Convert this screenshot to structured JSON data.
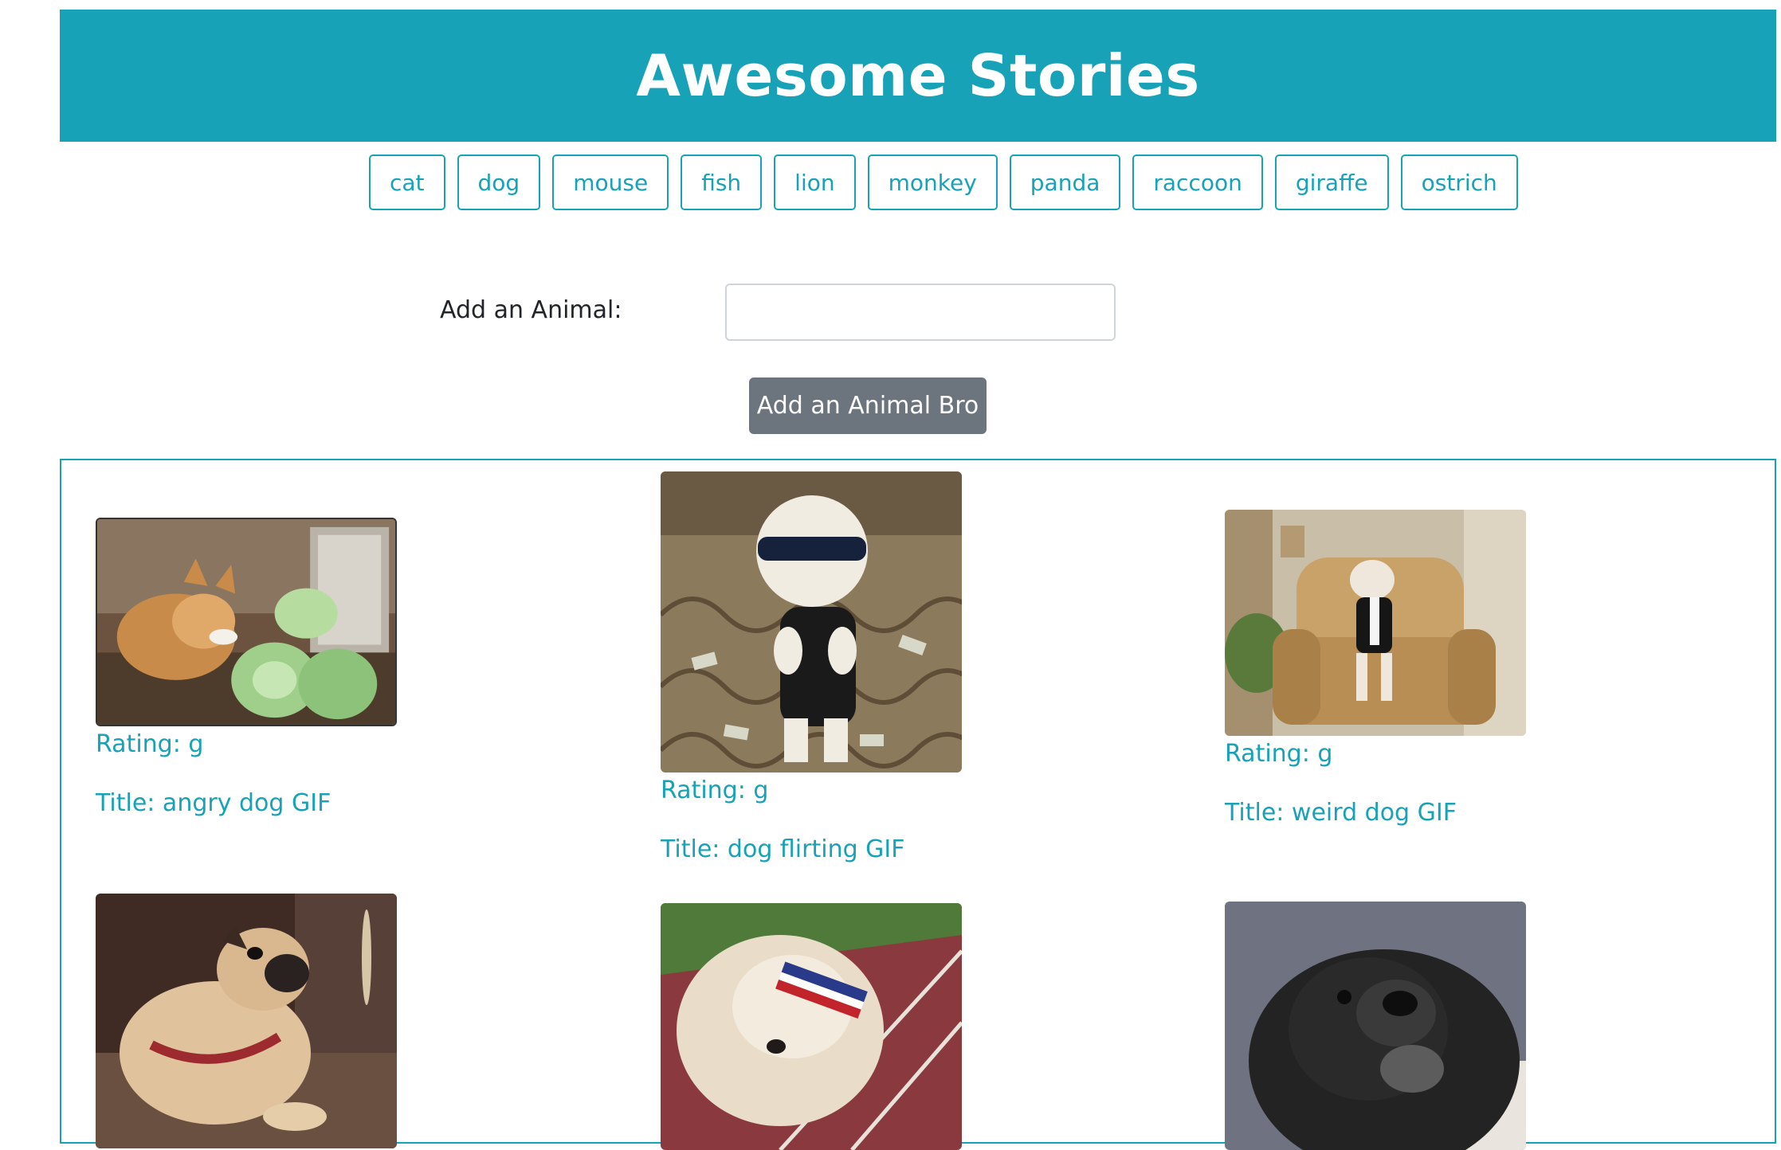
{
  "header": {
    "title": "Awesome Stories"
  },
  "animal_buttons": [
    "cat",
    "dog",
    "mouse",
    "fish",
    "lion",
    "monkey",
    "panda",
    "raccoon",
    "giraffe",
    "ostrich"
  ],
  "form": {
    "label": "Add an Animal:",
    "input_value": "",
    "submit_label": "Add an Animal Bro"
  },
  "gifs": [
    {
      "rating": "Rating: g",
      "title": "Title: angry dog GIF",
      "icon": "corgi-cabbage-image"
    },
    {
      "rating": "Rating: g",
      "title": "Title: dog flirting GIF",
      "icon": "dog-sunglasses-image"
    },
    {
      "rating": "Rating: g",
      "title": "Title: weird dog GIF",
      "icon": "dog-suit-chair-image"
    },
    {
      "icon": "pug-image"
    },
    {
      "icon": "fluffy-dog-headband-image"
    },
    {
      "icon": "black-dog-image"
    }
  ],
  "colors": {
    "accent": "#17a2b8",
    "secondary": "#6c757d"
  }
}
